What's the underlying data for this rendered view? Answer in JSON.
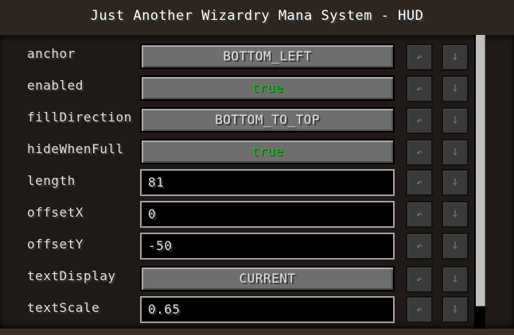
{
  "window": {
    "title": "Just Another Wizardry Mana System - HUD"
  },
  "icons": {
    "undo": "↶",
    "reset": "⸸"
  },
  "rows": [
    {
      "label": "anchor",
      "kind": "button",
      "value": "BOTTOM_LEFT"
    },
    {
      "label": "enabled",
      "kind": "toggle",
      "value": "true"
    },
    {
      "label": "fillDirection",
      "kind": "button",
      "value": "BOTTOM_TO_TOP"
    },
    {
      "label": "hideWhenFull",
      "kind": "toggle",
      "value": "true"
    },
    {
      "label": "length",
      "kind": "text",
      "value": "81"
    },
    {
      "label": "offsetX",
      "kind": "text",
      "value": "0"
    },
    {
      "label": "offsetY",
      "kind": "text",
      "value": "-50"
    },
    {
      "label": "textDisplay",
      "kind": "button",
      "value": "CURRENT"
    },
    {
      "label": "textScale",
      "kind": "text",
      "value": "0.65"
    }
  ]
}
